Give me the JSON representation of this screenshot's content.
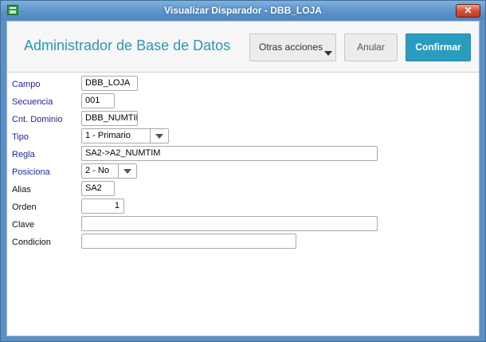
{
  "window": {
    "title": "Visualizar Disparador - DBB_LOJA",
    "close_label": "✕"
  },
  "header": {
    "title": "Administrador de Base de Datos",
    "otras_acciones_label": "Otras acciones",
    "anular_label": "Anular",
    "confirmar_label": "Confirmar"
  },
  "form": {
    "campo": {
      "label": "Campo",
      "value": "DBB_LOJA"
    },
    "secuencia": {
      "label": "Secuencia",
      "value": "001"
    },
    "cnt_dominio": {
      "label": "Cnt. Dominio",
      "value": "DBB_NUMTIM"
    },
    "tipo": {
      "label": "Tipo",
      "value": "1 - Primario"
    },
    "regla": {
      "label": "Regla",
      "value": "SA2->A2_NUMTIM"
    },
    "posiciona": {
      "label": "Posiciona",
      "value": "2 - No"
    },
    "alias": {
      "label": "Alias",
      "value": "SA2"
    },
    "orden": {
      "label": "Orden",
      "value": "1"
    },
    "clave": {
      "label": "Clave",
      "value": ""
    },
    "condicion": {
      "label": "Condicion",
      "value": ""
    }
  },
  "colors": {
    "accent": "#2a9cc0",
    "title_text": "#2b97b2",
    "required_label": "#1f1fa8",
    "titlebar": "#5f94cb"
  },
  "icons": {
    "app": "app-window-icon",
    "close": "close-icon",
    "dropdown": "chevron-down-icon"
  }
}
